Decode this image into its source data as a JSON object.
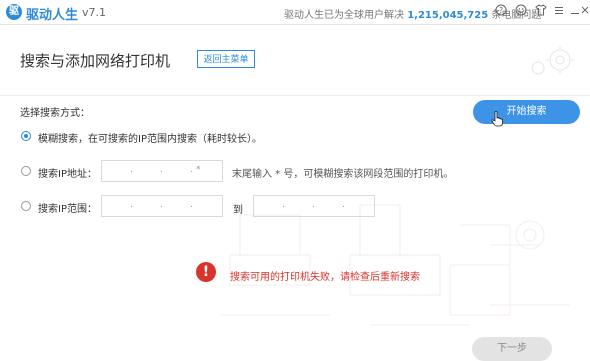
{
  "titlebar": {
    "app_name": "驱动人生",
    "version": "v7.1",
    "stats_prefix": "驱动人生已为全球用户解决",
    "stats_count": "1,215,045,725",
    "stats_suffix": "条电脑问题",
    "icons": [
      "help-icon",
      "smile-icon",
      "shirt-icon",
      "menu-icon",
      "minimize-icon",
      "close-icon"
    ]
  },
  "header": {
    "title": "搜索与添加网络打印机",
    "back_label": "返回主菜单"
  },
  "search": {
    "method_label": "选择搜索方式：",
    "start_label": "开始搜索",
    "options": [
      {
        "label": "模糊搜索，在可搜索的IP范围内搜索（耗时较长）。",
        "checked": true
      },
      {
        "label": "搜索IP地址：",
        "checked": false
      },
      {
        "label": "搜索IP范围：",
        "checked": false
      }
    ],
    "ip_hint": "末尾输入 * 号，可模糊搜索该网段范围的打印机。",
    "range_to": "到",
    "ip_star": "*"
  },
  "error": {
    "message": "搜索可用的打印机失败，请检查后重新搜索"
  },
  "footer": {
    "next_label": "下一步"
  },
  "colors": {
    "accent": "#2f8bd8",
    "button": "#3d94e6",
    "error": "#d9342b"
  }
}
